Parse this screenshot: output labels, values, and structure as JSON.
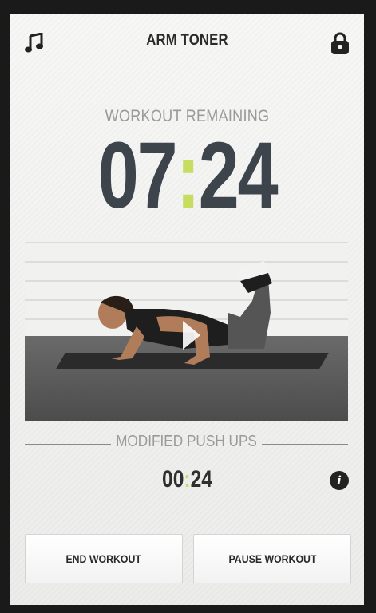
{
  "header": {
    "title": "ARM TONER",
    "left_icon": "music-note-icon",
    "right_icon": "lock-icon"
  },
  "workout": {
    "remaining_label": "WORKOUT REMAINING",
    "minutes": "07",
    "seconds": "24"
  },
  "video": {
    "description_icon": "play-icon"
  },
  "exercise": {
    "name": "MODIFIED PUSH UPS",
    "minutes": "00",
    "seconds": "24",
    "info_icon": "info-icon"
  },
  "buttons": {
    "end": "END WORKOUT",
    "pause": "PAUSE WORKOUT"
  },
  "colors": {
    "accent": "#c6dd62",
    "timer": "#3d444c"
  }
}
